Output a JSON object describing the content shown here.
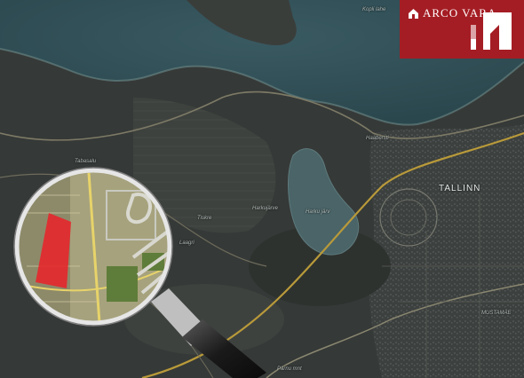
{
  "brand": {
    "name": "ARCO VARA",
    "color": "#a51d24"
  },
  "map": {
    "places": {
      "kopli_lahe": "Kopli lahe",
      "tabasalu": "Tabasalu",
      "haabersti": "Haabersti",
      "tallinn": "TALLINN",
      "harku_jarv": "Harku järv",
      "harkujarve": "Harkujärve",
      "tiskre": "Tiskre",
      "laagri": "Laagri",
      "mustamae": "MUSTAMÄE",
      "parnu_maantee": "Pärnu mnt"
    },
    "highlight_color": "#e8232a",
    "magnifier_icon": "magnifying-glass-icon"
  }
}
